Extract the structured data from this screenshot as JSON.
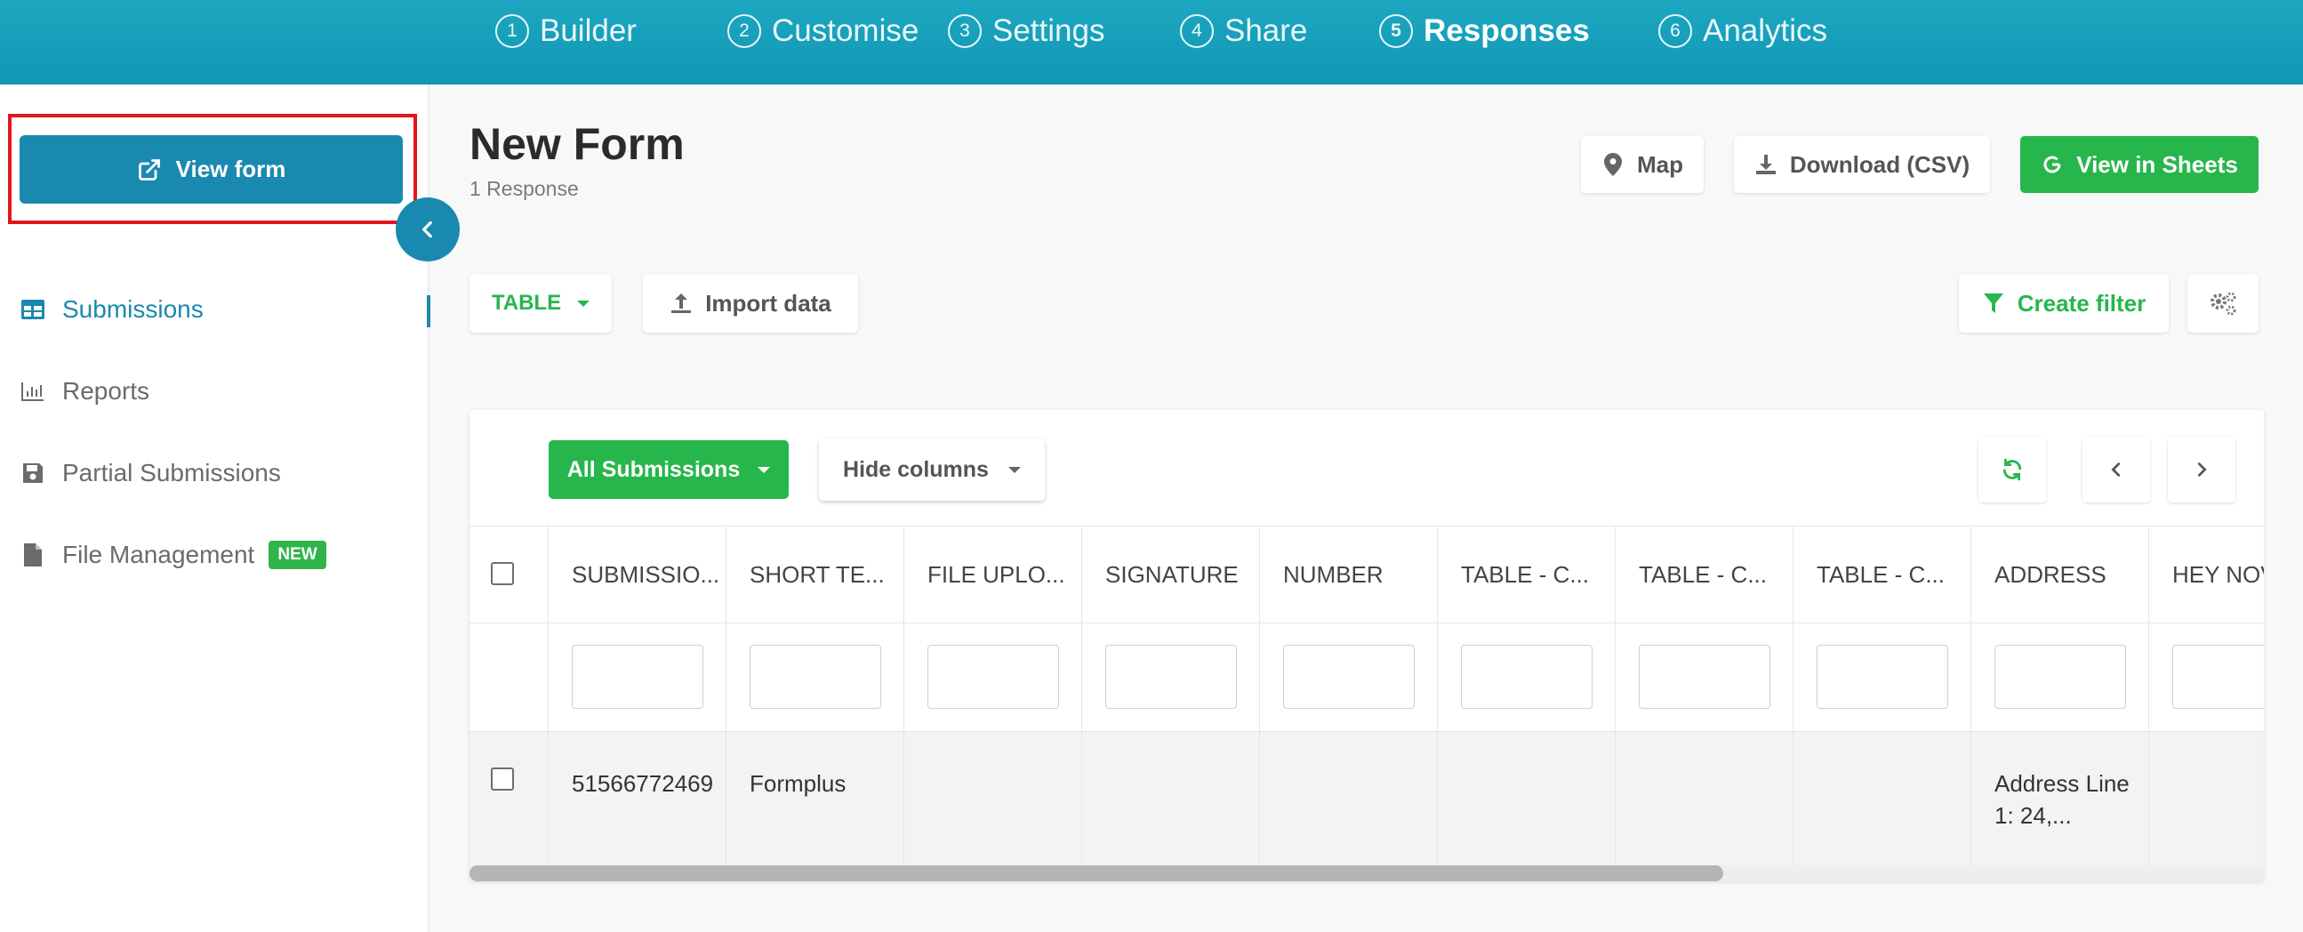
{
  "steps": [
    {
      "num": "1",
      "label": "Builder"
    },
    {
      "num": "2",
      "label": "Customise"
    },
    {
      "num": "3",
      "label": "Settings"
    },
    {
      "num": "4",
      "label": "Share"
    },
    {
      "num": "5",
      "label": "Responses"
    },
    {
      "num": "6",
      "label": "Analytics"
    }
  ],
  "sidebar": {
    "view_form_label": "View form",
    "items": [
      {
        "label": "Submissions",
        "icon": "table-icon"
      },
      {
        "label": "Reports",
        "icon": "bar-chart-icon"
      },
      {
        "label": "Partial Submissions",
        "icon": "save-icon"
      },
      {
        "label": "File Management",
        "icon": "file-icon",
        "badge": "NEW"
      }
    ]
  },
  "header": {
    "title": "New Form",
    "subtitle": "1 Response",
    "map_label": "Map",
    "download_label": "Download (CSV)",
    "sheets_label": "View in Sheets"
  },
  "toolbar": {
    "view_select": "TABLE",
    "import_label": "Import data",
    "filter_label": "Create filter"
  },
  "table": {
    "submissions_filter": "All Submissions",
    "hide_columns_label": "Hide columns",
    "columns": [
      "SUBMISSIO...",
      "SHORT TE...",
      "FILE UPLO...",
      "SIGNATURE",
      "NUMBER",
      "TABLE - C...",
      "TABLE - C...",
      "TABLE - C...",
      "ADDRESS",
      "HEY NOV"
    ],
    "rows": [
      [
        "51566772469",
        "Formplus",
        "",
        "",
        "",
        "",
        "",
        "",
        "Address Line 1: 24,...",
        ""
      ]
    ]
  },
  "colors": {
    "topbar": "#0f97b5",
    "primary": "#1a89b0",
    "green": "#27b64b",
    "highlight": "#e5141b"
  }
}
